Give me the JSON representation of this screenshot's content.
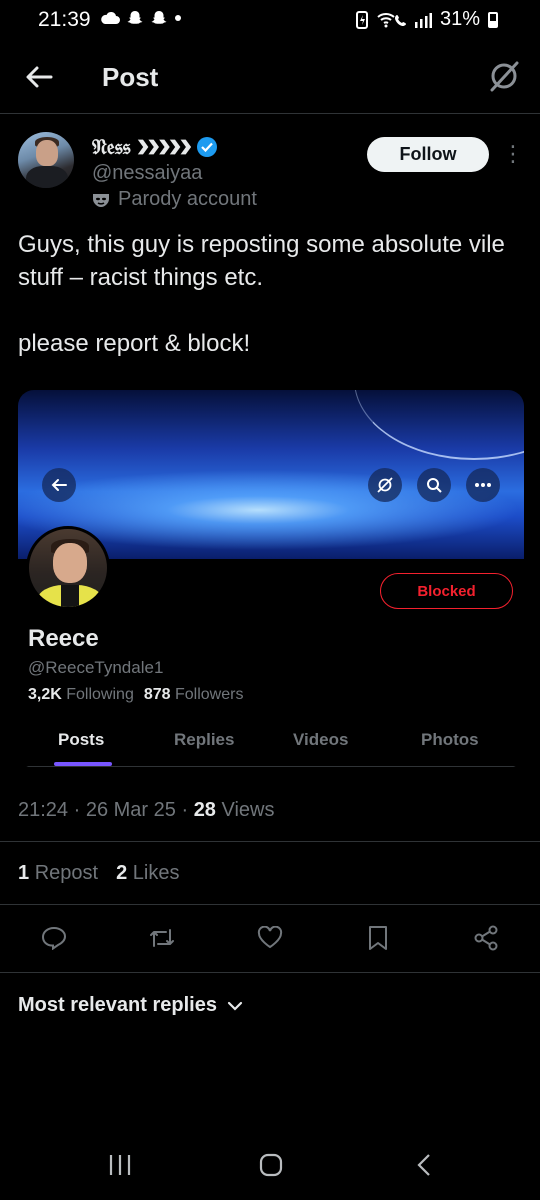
{
  "status_bar": {
    "time": "21:39",
    "battery": "31%"
  },
  "header": {
    "title": "Post"
  },
  "post": {
    "author": {
      "name": "𝔑𝔢𝔰𝔰 ❯❯❯❯❯",
      "handle": "@nessaiyaa",
      "label": "Parody account"
    },
    "follow_label": "Follow",
    "text_line1": "Guys, this guy is reposting some absolute vile stuff – racist things etc.",
    "text_line2": "please report & block!",
    "time": "21:24",
    "date": "26 Mar 25",
    "views_count": "28",
    "views_label": "Views",
    "repost_count": "1",
    "repost_label": "Repost",
    "likes_count": "2",
    "likes_label": "Likes"
  },
  "embedded_profile": {
    "blocked_label": "Blocked",
    "name": "Reece",
    "handle": "@ReeceTyndale1",
    "following_count": "3,2K",
    "following_label": "Following",
    "followers_count": "878",
    "followers_label": "Followers",
    "tabs": [
      "Posts",
      "Replies",
      "Videos",
      "Photos"
    ],
    "active_tab": "Posts"
  },
  "replies_sort": {
    "label": "Most relevant replies"
  },
  "colors": {
    "background": "#000000",
    "text_primary": "#e7e9ea",
    "text_secondary": "#71767b",
    "verified": "#1d9bf0",
    "blocked": "#f4212e",
    "tab_indicator": "#7856ff"
  }
}
